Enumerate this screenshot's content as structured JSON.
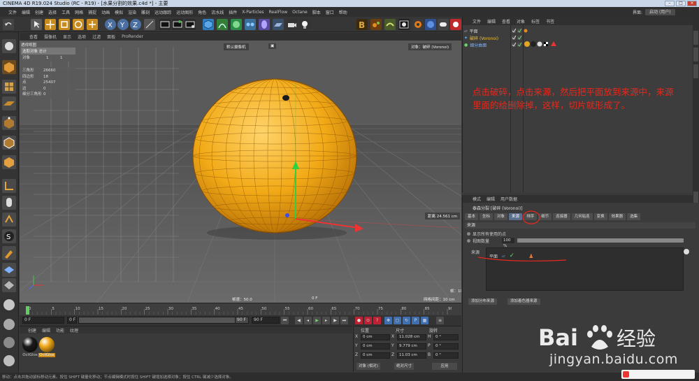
{
  "window": {
    "title": "CINEMA 4D R19.024 Studio (RC - R19) - [水果分割的效果.c4d *] - 主要"
  },
  "menu": {
    "items": [
      "文件",
      "编辑",
      "创建",
      "选择",
      "工具",
      "网格",
      "捕捉",
      "动画",
      "模拟",
      "渲染",
      "雕刻",
      "运动跟踪",
      "运动图形",
      "角色",
      "流水线",
      "插件",
      "X-Particles",
      "RealFlow",
      "Octane",
      "脚本",
      "窗口",
      "帮助"
    ],
    "layout_label": "界面:",
    "layout_value": "启动 (用户)"
  },
  "viewport": {
    "menu": [
      "查看",
      "摄像机",
      "显示",
      "选项",
      "过滤",
      "面板",
      "ProRender"
    ],
    "view_name": "透视视图",
    "camera_label": "默认摄像机",
    "camera_icon": "camera-icon",
    "object_label": "对象：破碎 (Voronoi)",
    "stats_header": "选取对象  总计",
    "stats_rows": [
      {
        "label": "对象",
        "a": "1",
        "b": "1"
      }
    ],
    "counts": [
      {
        "label": "三角形",
        "value": "26660"
      },
      {
        "label": "四边形",
        "value": "18"
      },
      {
        "label": "点",
        "value": "25407"
      },
      {
        "label": "边",
        "value": "0"
      },
      {
        "label": "细分三角形",
        "value": "0"
      }
    ],
    "grid_spacing": "网格间距：10 cm",
    "speed_label": "帧速：50.0",
    "frame_label": "0 F",
    "distance_label": "距离 24.561 cm",
    "axis_label": "帧：100"
  },
  "timeline": {
    "ticks": [
      "0",
      "5",
      "10",
      "15",
      "20",
      "25",
      "30",
      "35",
      "40",
      "45",
      "50",
      "55",
      "60",
      "65",
      "70",
      "75",
      "80",
      "85",
      "90"
    ],
    "current_frame": "0 F",
    "start_field": "0 F",
    "end_field": "90 F",
    "end_field2": "90 F"
  },
  "materials": {
    "menu": [
      "创建",
      "编辑",
      "功能",
      "纹理"
    ],
    "items": [
      {
        "label": "OctGlos",
        "color": "#1a1a1a"
      },
      {
        "label": "OctGlos",
        "color": "#f0a81a"
      }
    ]
  },
  "coords": {
    "headers": [
      "位置",
      "尺寸",
      "旋转"
    ],
    "rows": [
      {
        "axis": "X",
        "pos": "0 cm",
        "size": "11.028 cm",
        "rot_axis": "H",
        "rot": "0 °"
      },
      {
        "axis": "Y",
        "pos": "0 cm",
        "size": "9.779 cm",
        "rot_axis": "P",
        "rot": "0 °"
      },
      {
        "axis": "Z",
        "pos": "0 cm",
        "size": "11.03 cm",
        "rot_axis": "B",
        "rot": "0 °"
      }
    ],
    "mode": "对象 (相对)",
    "size_mode": "绝对尺寸",
    "apply": "应用"
  },
  "object_manager": {
    "menu": [
      "文件",
      "编辑",
      "查看",
      "对象",
      "标签",
      "书签"
    ],
    "objects": [
      {
        "name": "平面",
        "color": "#b8c8e0"
      },
      {
        "name": "破碎 (Voronoi)",
        "color": "#f0c040"
      },
      {
        "name": "细分曲面",
        "color": "#7fb2ff"
      }
    ],
    "annotation": "点击破碎，点击来源，然后把平面放到来源中，来源里面的给删除掉，这样，切片就形成了。"
  },
  "attribute_manager": {
    "menu": [
      "模式",
      "编辑",
      "用户数据"
    ],
    "title": "泰森分裂 [破碎 (Voronoi)]",
    "tabs": [
      "基本",
      "坐标",
      "对象",
      "来源",
      "排序",
      "细节",
      "连接器",
      "几何粘连",
      "变换",
      "效果器",
      "选集"
    ],
    "active_tab": "来源",
    "section": "来源",
    "opt_show_points": "显示所有使用的点",
    "opt_density_label": "视图数量",
    "opt_density_value": "100 %",
    "source_label": "来源",
    "source_item": "平面",
    "btn_add_point_source": "添加分布来源",
    "btn_add_shader_source": "添加着色器来源"
  },
  "status": {
    "text": "移动：点击并拖动鼠标移动元素。按住 SHIFT 键量化移动；节点编辑模式时按住 SHIFT 键增加选择对象；按住 CTRL 键减少选择对象。"
  },
  "watermark": {
    "logo_left": "Bai",
    "logo_right": "经验",
    "url": "jingyan.baidu.com"
  },
  "colors": {
    "sphere": "#f2aa17",
    "sphere_dark": "#c57d08",
    "annotation": "#e8281c",
    "active_tab": "#5a6f8e"
  }
}
